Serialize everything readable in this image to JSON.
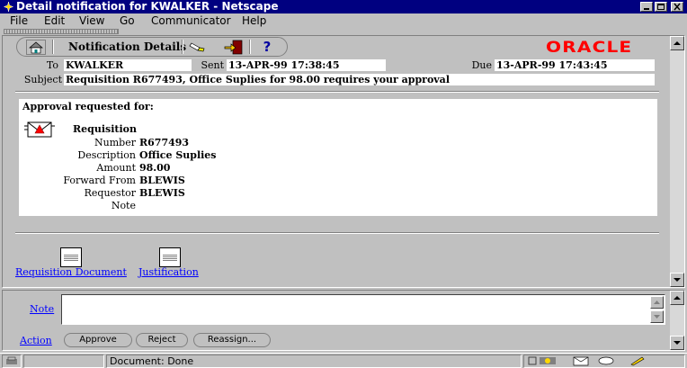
{
  "window": {
    "title": "Detail notification for KWALKER - Netscape"
  },
  "menu": [
    "File",
    "Edit",
    "View",
    "Go",
    "Communicator",
    "Help"
  ],
  "toolbar": {
    "title": "Notification Details",
    "help_glyph": "?"
  },
  "brand": {
    "logo_text": "ORACLE",
    "color": "#ff0000"
  },
  "header": {
    "to_label": "To",
    "to_value": "KWALKER",
    "sent_label": "Sent",
    "sent_value": "13-APR-99 17:38:45",
    "due_label": "Due",
    "due_value": "13-APR-99 17:43:45",
    "subject_label": "Subject",
    "subject_value": "Requisition R677493, Office Suplies for 98.00 requires your approval"
  },
  "body": {
    "heading": "Approval requested for:",
    "doc_type": "Requisition",
    "fields": [
      {
        "label": "Number",
        "value": "R677493"
      },
      {
        "label": "Description",
        "value": "Office Suplies"
      },
      {
        "label": "Amount",
        "value": "98.00"
      },
      {
        "label": "Forward From",
        "value": "BLEWIS"
      },
      {
        "label": "Requestor",
        "value": "BLEWIS"
      },
      {
        "label": "Note",
        "value": ""
      }
    ]
  },
  "attachments": [
    {
      "label": "Requisition Document"
    },
    {
      "label": "Justification"
    }
  ],
  "response": {
    "note_link": "Note",
    "note_value": "",
    "action_link": "Action",
    "buttons": [
      "Approve",
      "Reject",
      "Reassign..."
    ]
  },
  "status": {
    "text": "Document: Done"
  }
}
